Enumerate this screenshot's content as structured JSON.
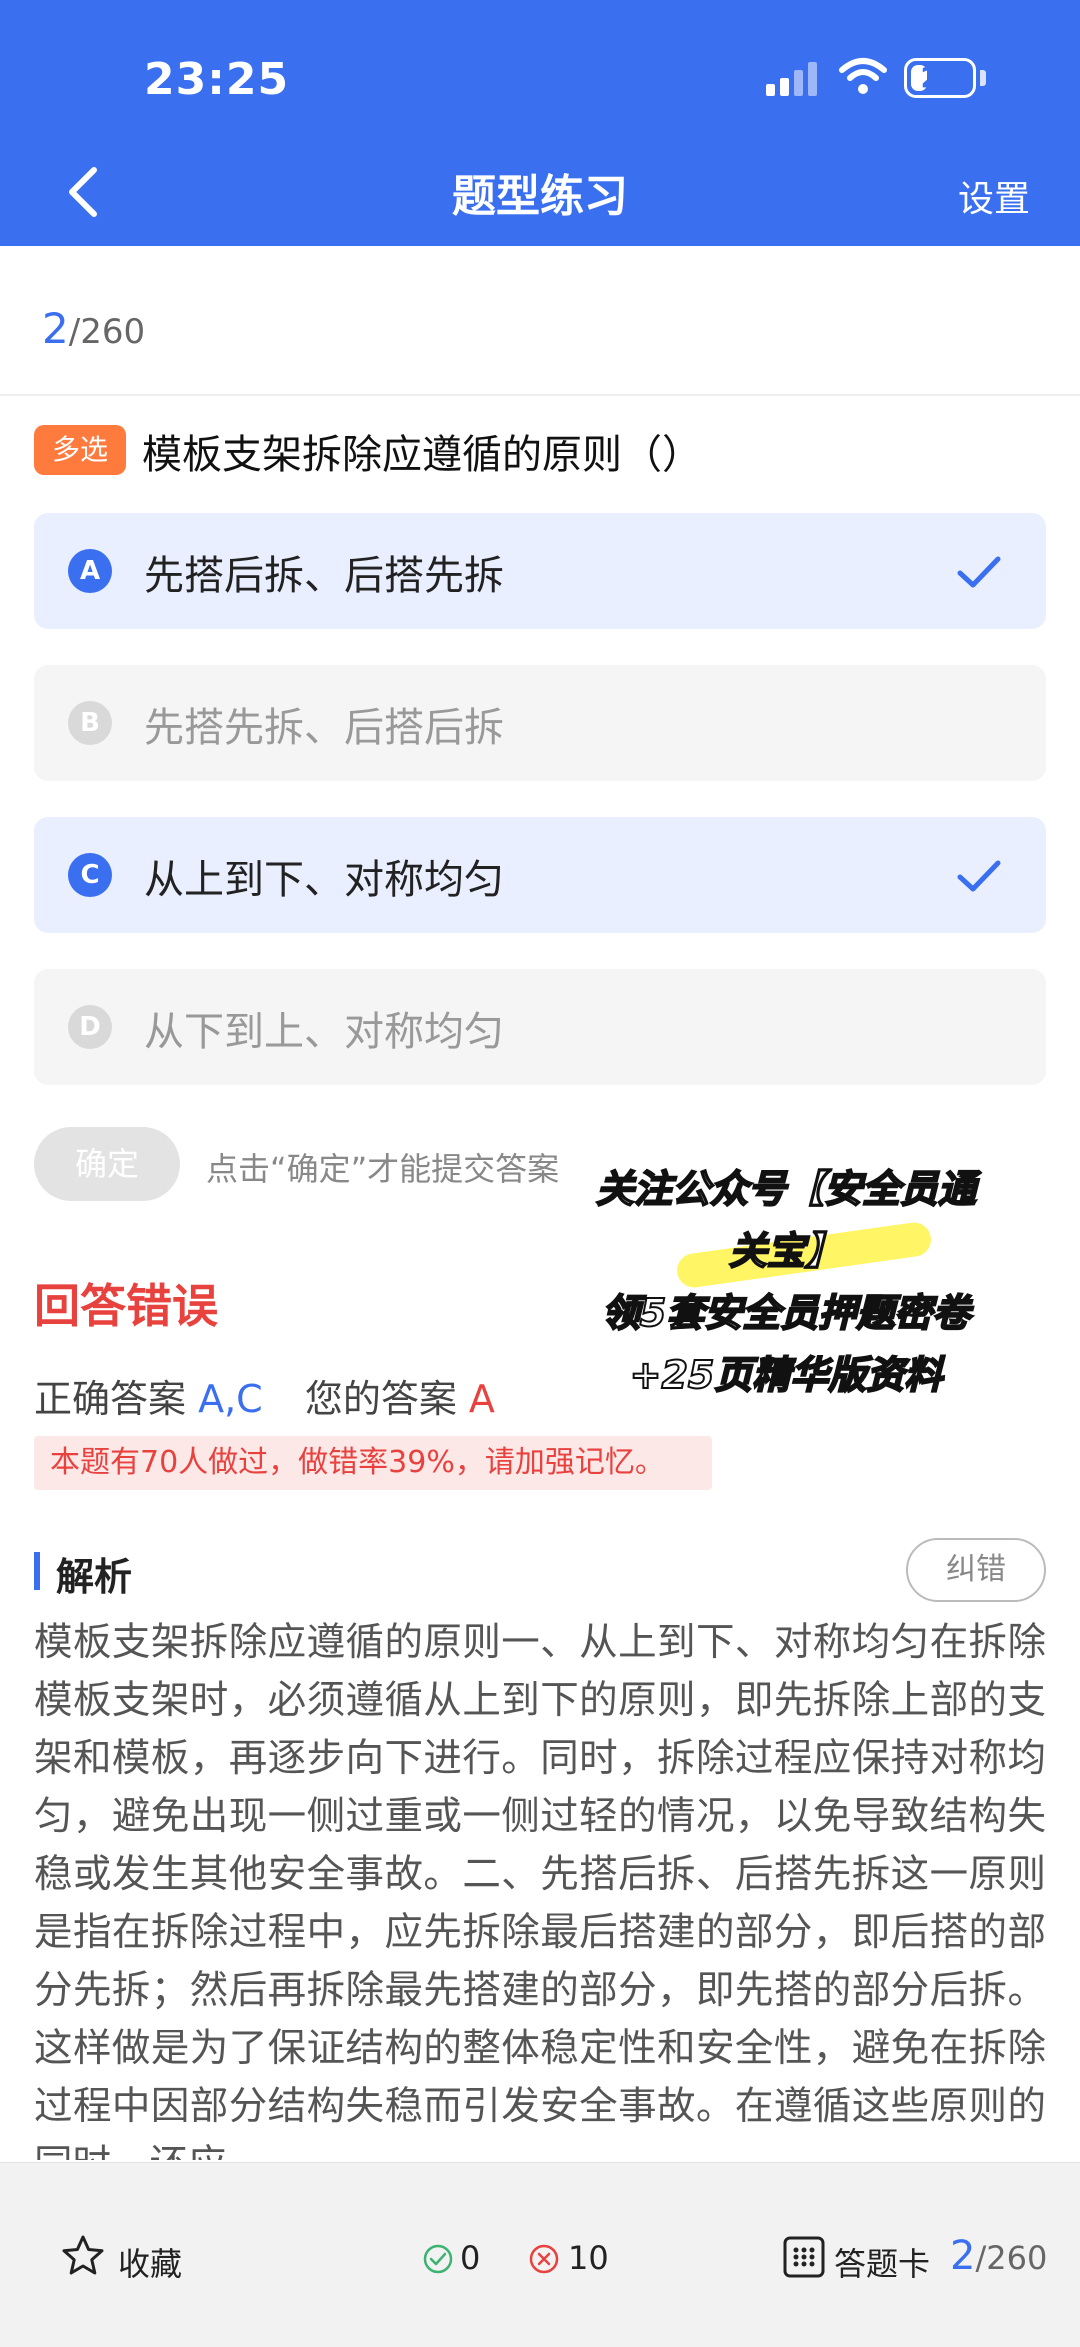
{
  "status_bar": {
    "time": "23:25",
    "battery": "27",
    "battery_level": 0.27
  },
  "header": {
    "title": "题型练习",
    "settings_label": "设置"
  },
  "progress": {
    "current": "2",
    "total": "/260"
  },
  "question": {
    "type_badge": "多选",
    "text": "模板支架拆除应遵循的原则（）",
    "options": [
      {
        "letter": "A",
        "text": "先搭后拆、后搭先拆",
        "selected": true
      },
      {
        "letter": "B",
        "text": "先搭先拆、后搭后拆",
        "selected": false
      },
      {
        "letter": "C",
        "text": "从上到下、对称均匀",
        "selected": true
      },
      {
        "letter": "D",
        "text": "从下到上、对称均匀",
        "selected": false
      }
    ]
  },
  "confirm": {
    "button_label": "确定",
    "hint": "点击“确定”才能提交答案"
  },
  "result": {
    "title": "回答错误",
    "correct_label": "正确答案",
    "correct_value": "A,C",
    "your_label": "您的答案",
    "your_value": "A",
    "error_note": "本题有70人做过，做错率39%，请加强记忆。"
  },
  "analysis": {
    "title": "解析",
    "report_label": "纠错",
    "text": "模板支架拆除应遵循的原则一、从上到下、对称均匀在拆除模板支架时，必须遵循从上到下的原则，即先拆除上部的支架和模板，再逐步向下进行。同时，拆除过程应保持对称均匀，避免出现一侧过重或一侧过轻的情况，以免导致结构失稳或发生其他安全事故。二、先搭后拆、后搭先拆这一原则是指在拆除过程中，应先拆除最后搭建的部分，即后搭的部分先拆；然后再拆除最先搭建的部分，即先搭的部分后拆。这样做是为了保证结构的整体稳定性和安全性，避免在拆除过程中因部分结构失稳而引发安全事故。在遵循这些原则的同时，还应"
  },
  "watermark": {
    "line1": "关注公众号【安全员通",
    "line2": "关宝】",
    "line3": "领5套安全员押题密卷",
    "line4": "+25页精华版资料"
  },
  "bottom_bar": {
    "favorite_label": "收藏",
    "correct_count": "0",
    "wrong_count": "10",
    "answer_card_label": "答题卡",
    "progress_current": "2",
    "progress_total": "/260"
  },
  "colors": {
    "accent": "#3a6ff0",
    "error": "#e8423f",
    "badge": "#ff7a3d"
  }
}
